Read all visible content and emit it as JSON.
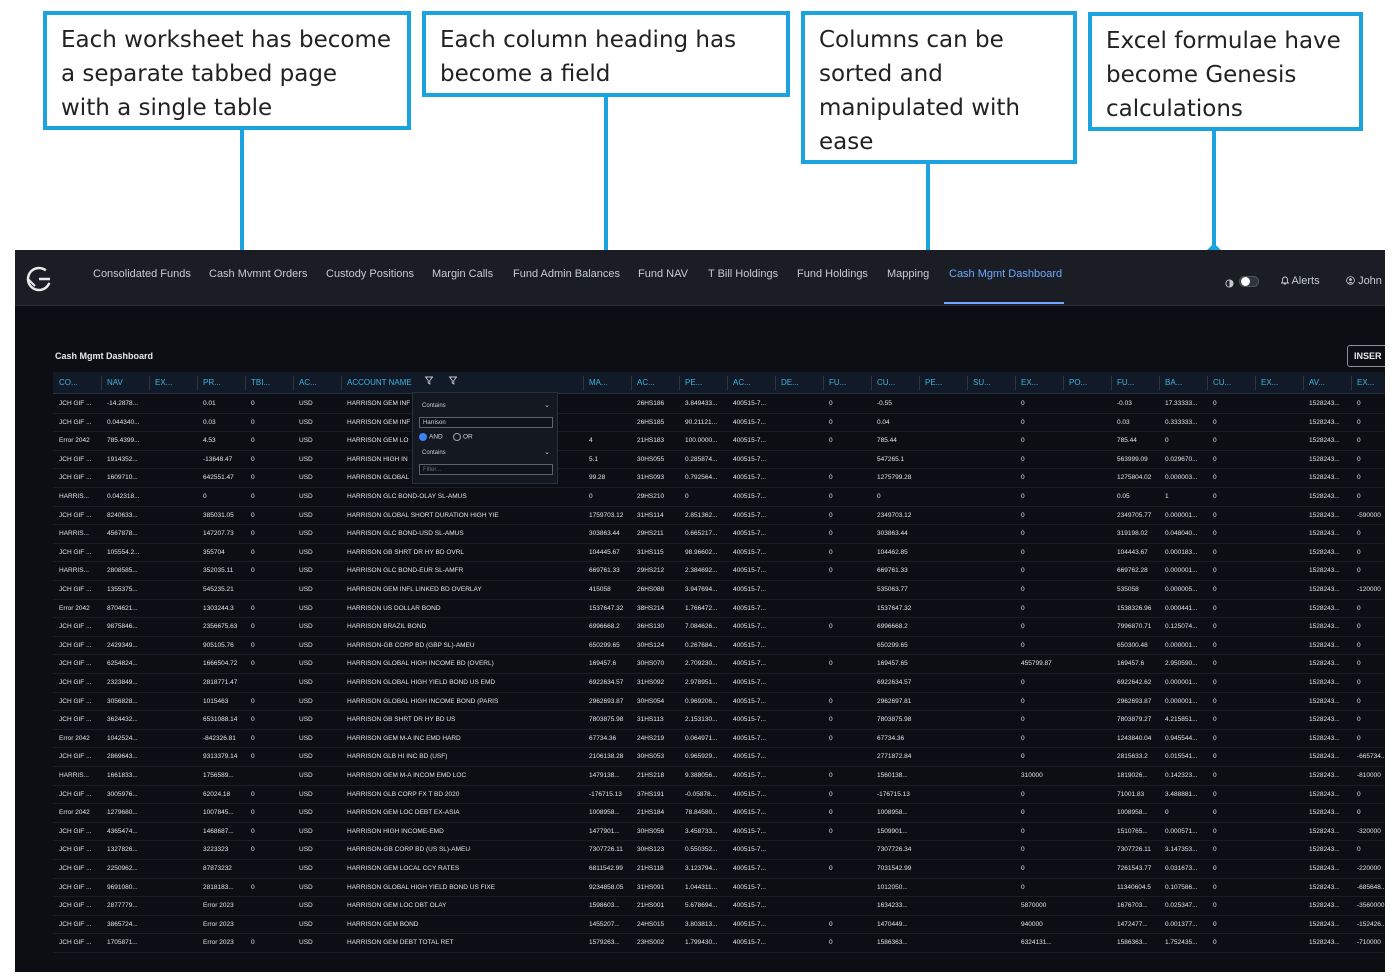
{
  "callouts": [
    {
      "text": "Each worksheet has become a separate tabbed page with a single table"
    },
    {
      "text": "Each column heading has become a field"
    },
    {
      "text": "Columns can be sorted and manipulated with ease"
    },
    {
      "text": "Excel formulae have become Genesis calculations"
    }
  ],
  "nav": {
    "tabs": [
      "Consolidated Funds",
      "Cash Mvmnt Orders",
      "Custody Positions",
      "Margin Calls",
      "Fund Admin Balances",
      "Fund NAV",
      "T Bill Holdings",
      "Fund Holdings",
      "Mapping",
      "Cash Mgmt Dashboard"
    ],
    "active": "Cash Mgmt Dashboard",
    "alerts_label": "Alerts",
    "user_label": "John"
  },
  "page": {
    "title": "Cash Mgmt Dashboard",
    "insert_label": "INSER"
  },
  "columns": [
    "CO...",
    "NAV",
    "EX...",
    "PR...",
    "TBI...",
    "AC...",
    "ACCOUNT NAME",
    "MA...",
    "AC...",
    "PE...",
    "AC...",
    "DE...",
    "FU...",
    "CU...",
    "PE...",
    "SU...",
    "EX...",
    "PO...",
    "FU...",
    "BA...",
    "CU...",
    "EX...",
    "AV...",
    "EX..."
  ],
  "filter": {
    "op1": "Contains",
    "value1": "Harrison",
    "and_label": "AND",
    "or_label": "OR",
    "op2": "Contains",
    "value2": "Filter..."
  },
  "rows": [
    [
      "JCH GIF ...",
      "-14.2878...",
      "",
      "0.01",
      "0",
      "USD",
      "HARRISON GEM INF",
      "",
      "26HS186",
      "3.849433...",
      "400515-7...",
      "",
      "0",
      "-0.55",
      "",
      "",
      "0",
      "",
      "-0.03",
      "17.33333...",
      "0",
      "",
      "1528243...",
      "0"
    ],
    [
      "JCH GIF ...",
      "0.044340...",
      "",
      "0.03",
      "0",
      "USD",
      "HARRISON GEM INF",
      "",
      "26HS185",
      "90.21121...",
      "400515-7...",
      "",
      "0",
      "0.04",
      "",
      "",
      "0",
      "",
      "0.03",
      "0.333333...",
      "0",
      "",
      "1528243...",
      "0"
    ],
    [
      "Error 2042",
      "785.4399...",
      "",
      "4.53",
      "0",
      "USD",
      "HARRISON GEM LO",
      "4",
      "21HS183",
      "100.0000...",
      "400515-7...",
      "",
      "0",
      "785.44",
      "",
      "",
      "0",
      "",
      "785.44",
      "0",
      "0",
      "",
      "1528243...",
      "0"
    ],
    [
      "JCH GIF ...",
      "1914352...",
      "",
      "-13648.47",
      "0",
      "USD",
      "HARRISON HIGH IN",
      "5.1",
      "30HS055",
      "0.285874...",
      "400515-7...",
      "",
      "",
      "547265.1",
      "",
      "",
      "0",
      "",
      "563999.09",
      "0.029670...",
      "0",
      "",
      "1528243...",
      "0"
    ],
    [
      "JCH GIF ...",
      "1609710...",
      "",
      "642551.47",
      "0",
      "USD",
      "HARRISON GLOBAL",
      "99.28",
      "31HS093",
      "0.792564...",
      "400515-7...",
      "",
      "0",
      "1275799.28",
      "",
      "",
      "0",
      "",
      "1275804.02",
      "0.000003...",
      "0",
      "",
      "1528243...",
      "0"
    ],
    [
      "HARRIS...",
      "0.042318...",
      "",
      "0",
      "0",
      "USD",
      "HARRISON GLC BOND-OLAY SL-AMUS",
      "0",
      "29HS210",
      "0",
      "400515-7...",
      "",
      "0",
      "0",
      "",
      "",
      "0",
      "",
      "0.05",
      "1",
      "0",
      "",
      "1528243...",
      "0"
    ],
    [
      "JCH GIF ...",
      "8240633...",
      "",
      "385031.05",
      "0",
      "USD",
      "HARRISON GLOBAL SHORT DURATION HIGH YIE",
      "1759703.12",
      "31HS114",
      "2.851362...",
      "400515-7...",
      "",
      "0",
      "2349703.12",
      "",
      "",
      "0",
      "",
      "2349705.77",
      "0.000001...",
      "0",
      "",
      "1528243...",
      "-590000"
    ],
    [
      "HARRIS...",
      "4567878...",
      "",
      "147207.73",
      "0",
      "USD",
      "HARRISON GLC BOND-USD SL-AMUS",
      "303863.44",
      "29HS211",
      "0.665217...",
      "400515-7...",
      "",
      "0",
      "303863.44",
      "",
      "",
      "0",
      "",
      "319198.02",
      "0.048040...",
      "0",
      "",
      "1528243...",
      "0"
    ],
    [
      "JCH GIF ...",
      "105554.2...",
      "",
      "355704",
      "0",
      "USD",
      "HARRISON GB SHRT DR HY BD OVRL",
      "104445.67",
      "31HS115",
      "98.96602...",
      "400515-7...",
      "",
      "0",
      "104462.85",
      "",
      "",
      "0",
      "",
      "104443.67",
      "0.000183...",
      "0",
      "",
      "1528243...",
      "0"
    ],
    [
      "HARRIS...",
      "2808585...",
      "",
      "352035.11",
      "0",
      "USD",
      "HARRISON GLC BOND-EUR SL-AMFR",
      "669761.33",
      "29HS212",
      "2.384692...",
      "400515-7...",
      "",
      "0",
      "669761.33",
      "",
      "",
      "0",
      "",
      "669762.28",
      "0.000001...",
      "0",
      "",
      "1528243...",
      "0"
    ],
    [
      "JCH GIF ...",
      "1355375...",
      "",
      "545235.21",
      "",
      "USD",
      "HARRISON GEM INFL LINKED BD OVERLAY",
      "415058",
      "26HS088",
      "3.947694...",
      "400515-7...",
      "",
      "",
      "535063.77",
      "",
      "",
      "0",
      "",
      "535058",
      "0.000005...",
      "0",
      "",
      "1528243...",
      "-120000"
    ],
    [
      "Error 2042",
      "8704621...",
      "",
      "1303244.3",
      "0",
      "USD",
      "HARRISON US DOLLAR BOND",
      "1537647.32",
      "38HS214",
      "1.766472...",
      "400515-7...",
      "",
      "",
      "1537647.32",
      "",
      "",
      "0",
      "",
      "1538326.96",
      "0.000441...",
      "0",
      "",
      "1528243...",
      "0"
    ],
    [
      "JCH GIF ...",
      "9875846...",
      "",
      "2356675.63",
      "0",
      "USD",
      "HARRISON BRAZIL BOND",
      "6996668.2",
      "36HS130",
      "7.084626...",
      "400515-7...",
      "",
      "0",
      "6996668.2",
      "",
      "",
      "0",
      "",
      "7996870.71",
      "0.125074...",
      "0",
      "",
      "1528243...",
      "0"
    ],
    [
      "JCH GIF ...",
      "2429349...",
      "",
      "905105.76",
      "0",
      "USD",
      "HARRISON-GB CORP BD (GBP SL)-AMEU",
      "650299.65",
      "30HS124",
      "0.267684...",
      "400515-7...",
      "",
      "",
      "650299.65",
      "",
      "",
      "0",
      "",
      "650300.48",
      "0.000001...",
      "0",
      "",
      "1528243...",
      "0"
    ],
    [
      "JCH GIF ...",
      "6254824...",
      "",
      "1666504.72",
      "0",
      "USD",
      "HARRISON GLOBAL HIGH INCOME BD (OVERL)",
      "169457.6",
      "30HS070",
      "2.709230...",
      "400515-7...",
      "",
      "0",
      "169457.65",
      "",
      "",
      "455799.87",
      "",
      "169457.6",
      "2.950590...",
      "0",
      "",
      "1528243...",
      "0"
    ],
    [
      "JCH GIF ...",
      "2323849...",
      "",
      "2818771.47",
      "",
      "USD",
      "HARRISON GLOBAL HIGH YIELD BOND US EMD",
      "6922634.57",
      "31HS092",
      "2.978951...",
      "400515-7...",
      "",
      "",
      "6922634.57",
      "",
      "",
      "0",
      "",
      "6922642.62",
      "0.000001...",
      "0",
      "",
      "1528243...",
      "0"
    ],
    [
      "JCH GIF ...",
      "3056828...",
      "",
      "1015463",
      "0",
      "USD",
      "HARRISON GLOBAL HIGH INCOME BOND (PARIS",
      "2962693.87",
      "30HS054",
      "0.969206...",
      "400515-7...",
      "",
      "0",
      "2962697.81",
      "",
      "",
      "0",
      "",
      "2962693.87",
      "0.000001...",
      "0",
      "",
      "1528243...",
      "0"
    ],
    [
      "JCH GIF ...",
      "3624432...",
      "",
      "6531088.14",
      "0",
      "USD",
      "HARRISON GB SHRT DR HY BD US",
      "7803875.98",
      "31HS113",
      "2.153130...",
      "400515-7...",
      "",
      "0",
      "7803875.98",
      "",
      "",
      "0",
      "",
      "7803879.27",
      "4.215851...",
      "0",
      "",
      "1528243...",
      "0"
    ],
    [
      "Error 2042",
      "1042524...",
      "",
      "-842326.81",
      "0",
      "USD",
      "HARRISON GEM M-A INC EMD HARD",
      "67734.36",
      "24HS219",
      "0.064971...",
      "400515-7...",
      "",
      "0",
      "67734.36",
      "",
      "",
      "0",
      "",
      "1243840.04",
      "0.945544...",
      "0",
      "",
      "1528243...",
      "0"
    ],
    [
      "JCH GIF ...",
      "2869643...",
      "",
      "9313379.14",
      "0",
      "USD",
      "HARRISON GLB HI INC BD (USF)",
      "2106138.28",
      "30HS053",
      "0.965929...",
      "400515-7...",
      "",
      "",
      "2771872.84",
      "",
      "",
      "0",
      "",
      "2815633.2",
      "0.015541...",
      "0",
      "",
      "1528243...",
      "-665734..."
    ],
    [
      "HARRIS...",
      "1661833...",
      "",
      "1756589...",
      "",
      "USD",
      "HARRISON GEM M-A INCOM EMD LOC",
      "1479138...",
      "21HS218",
      "9.388056...",
      "400515-7...",
      "",
      "0",
      "1560138...",
      "",
      "",
      "310000",
      "",
      "1819026...",
      "0.142323...",
      "0",
      "",
      "1528243...",
      "-810000"
    ],
    [
      "JCH GIF ...",
      "3005976...",
      "",
      "62024.18",
      "0",
      "USD",
      "HARRISON GLB CORP FX T BD 2020",
      "-176715.13",
      "37HS191",
      "-0.05878...",
      "400515-7...",
      "",
      "0",
      "-176715.13",
      "",
      "",
      "0",
      "",
      "71001.83",
      "3.488881...",
      "0",
      "",
      "1528243...",
      "0"
    ],
    [
      "Error 2042",
      "1279680...",
      "",
      "1007845...",
      "0",
      "USD",
      "HARRISON GEM LOC DEBT EX-ASIA",
      "1008958...",
      "21HS184",
      "78.84580...",
      "400515-7...",
      "",
      "0",
      "1008958...",
      "",
      "",
      "0",
      "",
      "1008958...",
      "0",
      "0",
      "",
      "1528243...",
      "0"
    ],
    [
      "JCH GIF ...",
      "4365474...",
      "",
      "1468687...",
      "0",
      "USD",
      "HARRISON HIGH INCOME-EMD",
      "1477901...",
      "30HS056",
      "3.458733...",
      "400515-7...",
      "",
      "0",
      "1509901...",
      "",
      "",
      "0",
      "",
      "1510765...",
      "0.000571...",
      "0",
      "",
      "1528243...",
      "-320000"
    ],
    [
      "JCH GIF ...",
      "1327826...",
      "",
      "3223323",
      "0",
      "USD",
      "HARRISON-GB CORP BD (US SL)-AMEU",
      "7307726.11",
      "30HS123",
      "0.550352...",
      "400515-7...",
      "",
      "",
      "7307726.34",
      "",
      "",
      "0",
      "",
      "7307726.11",
      "3.147353...",
      "0",
      "",
      "1528243...",
      "0"
    ],
    [
      "JCH GIF ...",
      "2250962...",
      "",
      "87873232",
      "",
      "USD",
      "HARRISON GEM LOCAL CCY RATES",
      "6811542.99",
      "21HS118",
      "3.123794...",
      "400515-7...",
      "",
      "0",
      "7031542.99",
      "",
      "",
      "0",
      "",
      "7261543.77",
      "0.031673...",
      "0",
      "",
      "1528243...",
      "-220000"
    ],
    [
      "JCH GIF ...",
      "9691080...",
      "",
      "2818183...",
      "0",
      "USD",
      "HARRISON GLOBAL HIGH YIELD BOND US FIXE",
      "9234858.05",
      "31HS091",
      "1.044311...",
      "400515-7...",
      "",
      "",
      "1012050...",
      "",
      "",
      "0",
      "",
      "11340604.5",
      "0.107586...",
      "0",
      "",
      "1528243...",
      "-685648..."
    ],
    [
      "JCH GIF ...",
      "2877779...",
      "",
      "Error 2023",
      "",
      "USD",
      "HARRISON GEM LOC DBT OLAY",
      "1598603...",
      "21HS001",
      "5.678694...",
      "400515-7...",
      "",
      "",
      "1634233...",
      "",
      "",
      "5870000",
      "",
      "1676703...",
      "0.025347...",
      "0",
      "",
      "1528243...",
      "-3560000"
    ],
    [
      "JCH GIF ...",
      "3865724...",
      "",
      "Error 2023",
      "",
      "USD",
      "HARRISON GEM BOND",
      "1455207...",
      "24HS015",
      "3.803813...",
      "400515-7...",
      "",
      "0",
      "1470449...",
      "",
      "",
      "940000",
      "",
      "1472477...",
      "0.001377...",
      "0",
      "",
      "1528243...",
      "-152426..."
    ],
    [
      "JCH GIF ...",
      "1705871...",
      "",
      "Error 2023",
      "0",
      "USD",
      "HARRISON GEM DEBT TOTAL RET",
      "1579263...",
      "23HS002",
      "1.799430...",
      "400515-7...",
      "",
      "0",
      "1586363...",
      "",
      "",
      "6324131...",
      "",
      "1586363...",
      "1.752435...",
      "0",
      "",
      "1528243...",
      "-710000"
    ]
  ]
}
